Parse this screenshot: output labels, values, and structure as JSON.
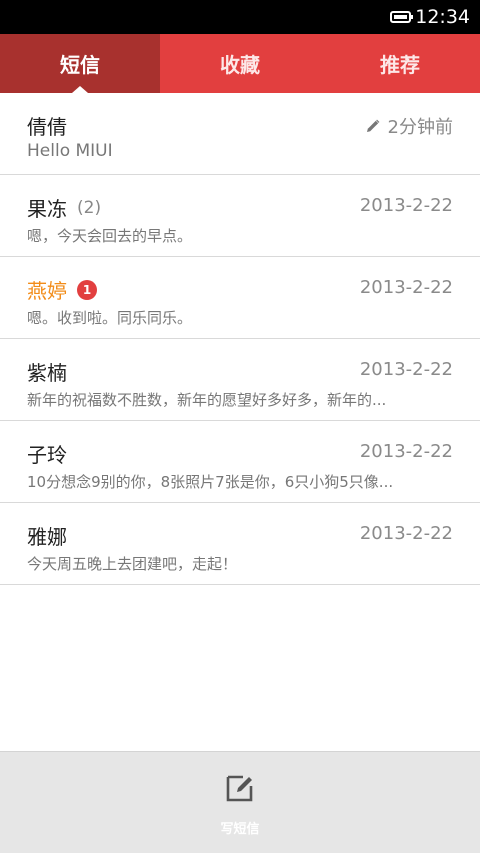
{
  "status_bar": {
    "time": "12:34",
    "battery_icon": "battery-icon"
  },
  "tabs": [
    {
      "label": "短信",
      "active": true
    },
    {
      "label": "收藏",
      "active": false
    },
    {
      "label": "推荐",
      "active": false
    }
  ],
  "messages": [
    {
      "name": "倩倩",
      "date": "2分钟前",
      "draft_icon": "pencil-icon",
      "preview": "Hello MIUI"
    },
    {
      "name": "果冻",
      "count": "(2)",
      "date": "2013-2-22",
      "preview": "嗯，今天会回去的早点。"
    },
    {
      "name": "燕婷",
      "badge": "1",
      "unread": true,
      "date": "2013-2-22",
      "preview": "嗯。收到啦。同乐同乐。"
    },
    {
      "name": "紫楠",
      "date": "2013-2-22",
      "preview": "新年的祝福数不胜数，新年的愿望好多好多，新年的..."
    },
    {
      "name": "子玲",
      "date": "2013-2-22",
      "preview": "10分想念9别的你，8张照片7张是你，6只小狗5只像..."
    },
    {
      "name": "雅娜",
      "date": "2013-2-22",
      "preview": "今天周五晚上去团建吧，走起！"
    }
  ],
  "bottom_bar": {
    "compose_label": "写短信",
    "compose_icon": "compose-icon"
  },
  "colors": {
    "accent": "#e23f3f",
    "active_tab": "#a8312e",
    "unread_name": "#f28c19"
  }
}
